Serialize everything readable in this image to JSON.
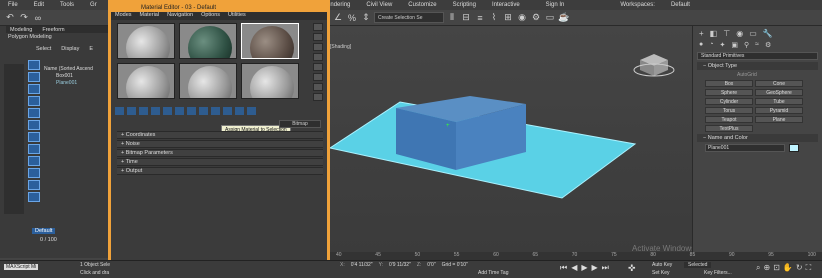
{
  "menubar": [
    "File",
    "Edit",
    "Tools",
    "Gr",
    "Rendering",
    "Civil View",
    "Customize",
    "Scripting",
    "Interactive",
    "Sign In",
    "Workspaces:",
    "Default"
  ],
  "toolbar": {
    "selection_set": "Create Selection Se"
  },
  "left_panel": {
    "tabs": [
      "Modeling",
      "Freeform",
      "Polygon Modeling"
    ],
    "scene_explorer": [
      "Select",
      "Display",
      "E"
    ],
    "name_header": "Name (Sorted Ascend",
    "objects": [
      "Box001",
      "Plane001"
    ]
  },
  "material_editor": {
    "title": "Material Editor - 03 - Default",
    "menu": [
      "Modes",
      "Material",
      "Navigation",
      "Options",
      "Utilities"
    ],
    "tooltip": "Assign Material to Selection",
    "map_label": "Bitmap",
    "rollouts": [
      "Coordinates",
      "Noise",
      "Bitmap Parameters",
      "Time",
      "Output"
    ]
  },
  "viewport": {
    "label": "[Shading]"
  },
  "command_panel": {
    "category": "Standard Primitives",
    "object_type": "Object Type",
    "autogrid": "AutoGrid",
    "objects": [
      "Box",
      "Cone",
      "Sphere",
      "GeoSphere",
      "Cylinder",
      "Tube",
      "Torus",
      "Pyramid",
      "Teapot",
      "Plane",
      "TextPlus"
    ],
    "name_color": "Name and Color",
    "name_value": "Plane001"
  },
  "statusbar": {
    "frame": "0 / 100",
    "object_selected": "1 Object Sele",
    "click_drag": "Click and dra",
    "x": "0'4 11/32\"",
    "y": "0'9 11/32\"",
    "z": "0'0\"",
    "grid": "Grid = 0'10\"",
    "add_time_tag": "Add Time Tag",
    "autokey": "Auto Key",
    "selected": "Selected",
    "setkey": "Set Key",
    "keyfilters": "Key Filters...",
    "layer": "Default",
    "maxscript": "MAXScript Mi"
  },
  "timeline_ticks": [
    "40",
    "45",
    "50",
    "55",
    "60",
    "65",
    "70",
    "75",
    "80",
    "85",
    "90",
    "95",
    "100"
  ],
  "watermark": "Activate Windows"
}
